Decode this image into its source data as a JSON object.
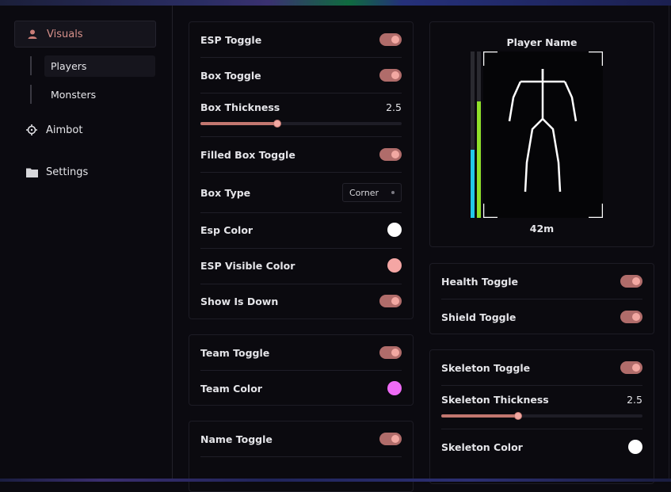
{
  "sidebar": {
    "visuals": "Visuals",
    "players": "Players",
    "monsters": "Monsters",
    "aimbot": "Aimbot",
    "settings": "Settings"
  },
  "esp_panel": {
    "esp_toggle": "ESP Toggle",
    "box_toggle": "Box Toggle",
    "box_thickness": "Box Thickness",
    "box_thickness_value": "2.5",
    "box_thickness_fraction": 0.38,
    "filled_box_toggle": "Filled Box Toggle",
    "box_type": "Box Type",
    "box_type_value": "Corner",
    "esp_color": "Esp Color",
    "esp_color_hex": "#ffffff",
    "esp_visible_color": "ESP Visible Color",
    "esp_visible_color_hex": "#f4a6a4",
    "show_is_down": "Show Is Down"
  },
  "team_panel": {
    "team_toggle": "Team Toggle",
    "team_color": "Team Color",
    "team_color_hex": "#ee6bf5"
  },
  "name_panel": {
    "name_toggle": "Name Toggle"
  },
  "preview": {
    "player_name": "Player Name",
    "distance": "42m",
    "health_fraction": 0.41,
    "shield_fraction": 0.7,
    "health_color": "#21c9e8",
    "shield_color": "#8fe02a"
  },
  "health_panel": {
    "health_toggle": "Health Toggle",
    "shield_toggle": "Shield Toggle"
  },
  "skeleton_panel": {
    "skeleton_toggle": "Skeleton Toggle",
    "skeleton_thickness": "Skeleton Thickness",
    "skeleton_thickness_value": "2.5",
    "skeleton_thickness_fraction": 0.38,
    "skeleton_color": "Skeleton Color",
    "skeleton_color_hex": "#ffffff"
  },
  "colors": {
    "accent": "#d6908a",
    "toggle_track": "#b06c6a",
    "toggle_knob": "#f2a8a2"
  }
}
